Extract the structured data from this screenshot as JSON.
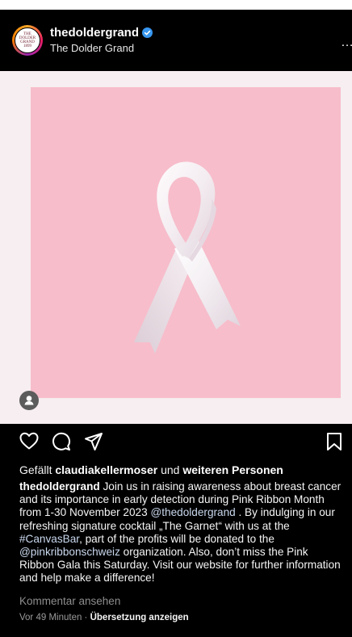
{
  "account": {
    "username": "thedoldergrand",
    "display_name": "The Dolder Grand",
    "logo_lines": [
      "THE",
      "DOLDER",
      "GRAND",
      "1899"
    ]
  },
  "post": {
    "likes_prefix": "Gefällt ",
    "likes_user": "claudiakellermoser",
    "likes_mid": " und ",
    "likes_rest": "weiteren Personen",
    "caption_username": "thedoldergrand",
    "caption_part1": " Join us in raising awareness about breast cancer and its importance in early detection during Pink Ribbon Month from 1-30 November 2023 ",
    "mention1": "@thedoldergrand",
    "caption_part2": " . By indulging in our refreshing signature cocktail „The Garnet“ with us at the ",
    "hashtag1": "#CanvasBar",
    "caption_part3": ", part of the profits will be donated to the ",
    "mention2": "@pinkribbonschweiz",
    "caption_part4": " organization. Also, don’t miss the Pink Ribbon Gala this Saturday. Visit our website for further information and help make a difference!",
    "view_comments": "Kommentar ansehen",
    "time_ago": "Vor 49 Minuten",
    "separator": " · ",
    "translate": "Übersetzung anzeigen"
  },
  "colors": {
    "background": "#000000",
    "media_pink": "#f7bdcb",
    "link": "#c9d8ee",
    "verified_blue": "#3897f0"
  },
  "icons": {
    "like": "heart-icon",
    "comment": "comment-icon",
    "share": "send-icon",
    "save": "bookmark-icon",
    "more": "more-icon",
    "user_tag": "user-tag-icon"
  }
}
